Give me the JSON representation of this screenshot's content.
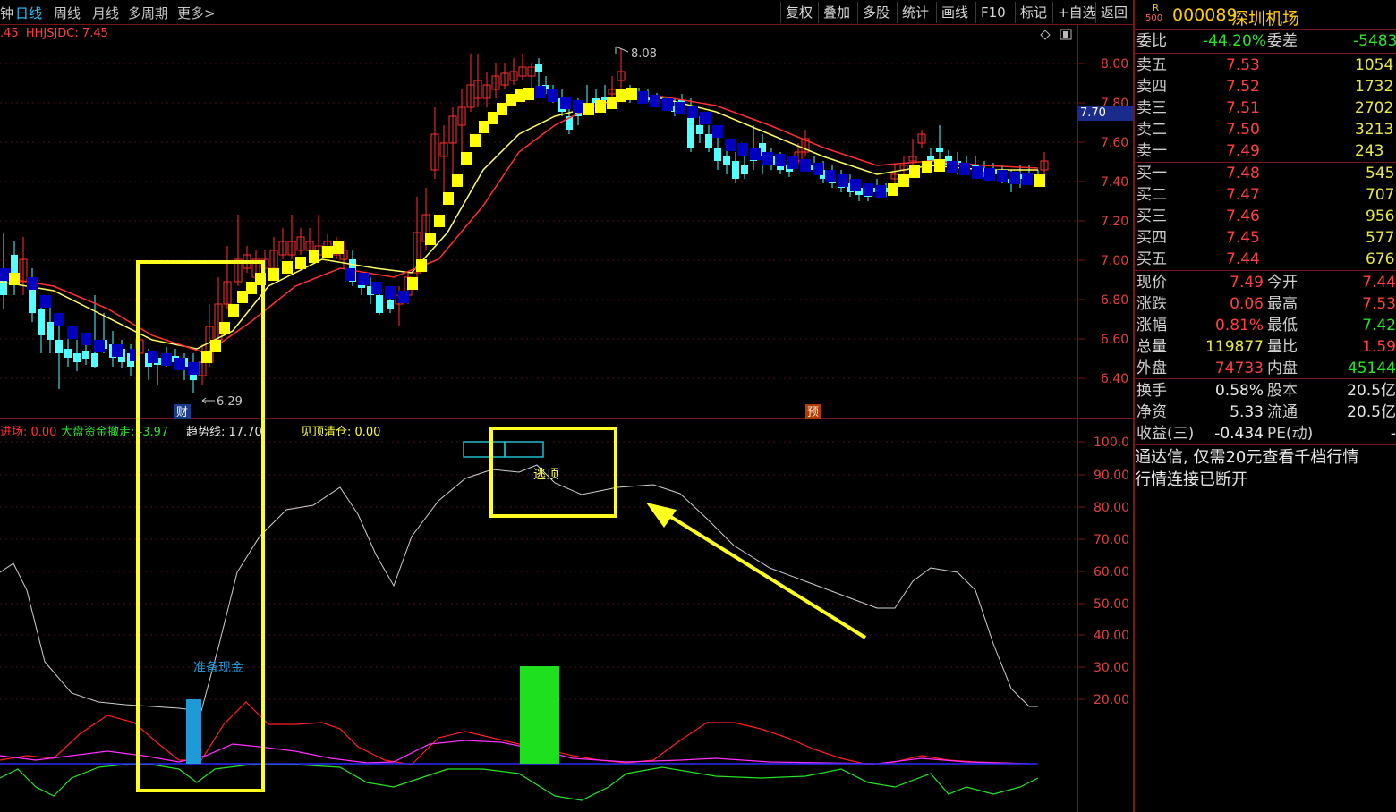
{
  "toolbar": {
    "timeframes": [
      "日线",
      "周线",
      "月线",
      "多周期",
      "更多>"
    ],
    "left_partial": "钟",
    "buttons": [
      "复权",
      "叠加",
      "多股",
      "统计",
      "画线",
      "F10",
      "标记",
      "+自选",
      "返回"
    ]
  },
  "indicator_header": {
    "partial_value": ".45",
    "name": "HHJSJDC:",
    "value": "7.45"
  },
  "sub_header": {
    "jinchang": "进场: 0.00",
    "dapan": "大盘资金撤走: -3.97",
    "trend": "趋势线: 17.70",
    "jianding": "见顶清仓: 0.00"
  },
  "price_axis": [
    "8.00",
    "7.80",
    "7.60",
    "7.40",
    "7.20",
    "7.00",
    "6.80",
    "6.60",
    "6.40"
  ],
  "current_price_tag": "7.70",
  "osc_axis": [
    "100.0",
    "90.00",
    "80.00",
    "70.00",
    "60.00",
    "50.00",
    "40.00",
    "30.00",
    "20.00"
  ],
  "annotations": {
    "high": "8.08",
    "low": "6.29",
    "cai_badge": "财",
    "yu_badge": "预",
    "escape_top": "逃顶",
    "prepare_cash": "准备现金"
  },
  "quote": {
    "badge_top": "R",
    "badge_bottom": "500",
    "code": "000089",
    "name": "深圳机场",
    "weibi_label": "委比",
    "weibi": "-44.20%",
    "weicha_label": "委差",
    "weicha": "-5483",
    "asks": [
      {
        "label": "卖五",
        "price": "7.53",
        "vol": "1054"
      },
      {
        "label": "卖四",
        "price": "7.52",
        "vol": "1732"
      },
      {
        "label": "卖三",
        "price": "7.51",
        "vol": "2702"
      },
      {
        "label": "卖二",
        "price": "7.50",
        "vol": "3213"
      },
      {
        "label": "卖一",
        "price": "7.49",
        "vol": "243"
      }
    ],
    "bids": [
      {
        "label": "买一",
        "price": "7.48",
        "vol": "545"
      },
      {
        "label": "买二",
        "price": "7.47",
        "vol": "707"
      },
      {
        "label": "买三",
        "price": "7.46",
        "vol": "956"
      },
      {
        "label": "买四",
        "price": "7.45",
        "vol": "577"
      },
      {
        "label": "买五",
        "price": "7.44",
        "vol": "676"
      }
    ],
    "stats": [
      {
        "l1": "现价",
        "v1": "7.49",
        "l2": "今开",
        "v2": "7.44"
      },
      {
        "l1": "涨跌",
        "v1": "0.06",
        "l2": "最高",
        "v2": "7.53"
      },
      {
        "l1": "涨幅",
        "v1": "0.81%",
        "l2": "最低",
        "v2": "7.42"
      },
      {
        "l1": "总量",
        "v1": "119877",
        "l2": "量比",
        "v2": "1.59"
      },
      {
        "l1": "外盘",
        "v1": "74733",
        "l2": "内盘",
        "v2": "45144"
      }
    ],
    "fundamentals": [
      {
        "l1": "换手",
        "v1": "0.58%",
        "l2": "股本",
        "v2": "20.5亿"
      },
      {
        "l1": "净资",
        "v1": "5.33",
        "l2": "流通",
        "v2": "20.5亿"
      },
      {
        "l1": "收益(三)",
        "v1": "-0.434",
        "l2": "PE(动)",
        "v2": "-"
      }
    ],
    "messages": [
      "通达信, 仅需20元查看千档行情",
      "行情连接已断开"
    ]
  },
  "colors": {
    "red_line": "#7a1515",
    "up": "#ff3030",
    "down": "#54ffff",
    "yellow": "#ffff00",
    "navy": "#0000c0",
    "green_bar": "#1ee01e",
    "blue_bar": "#1e9ad6"
  }
}
